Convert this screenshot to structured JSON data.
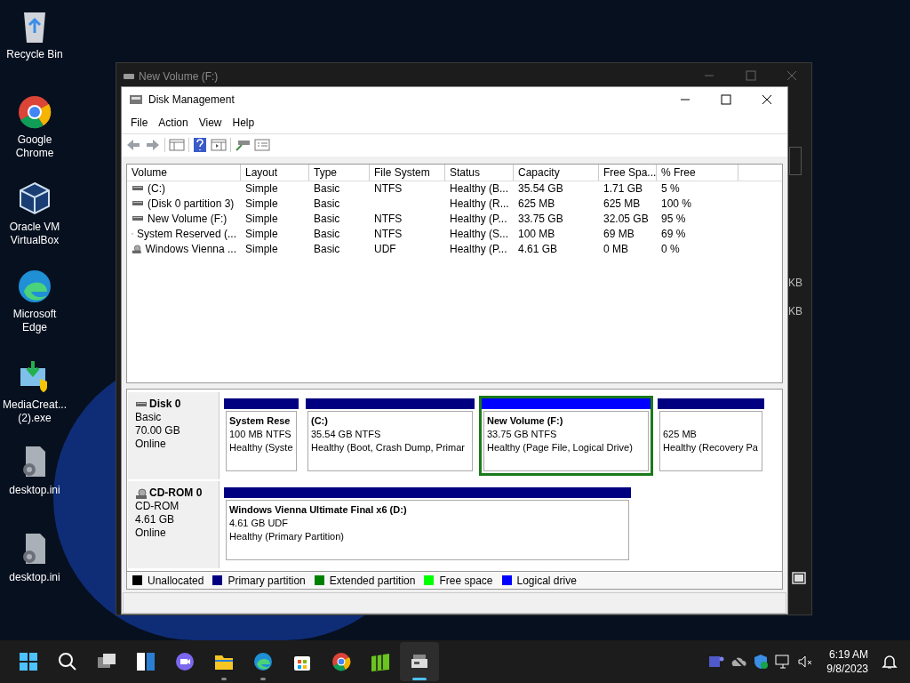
{
  "desktop_icons": [
    {
      "kind": "recycle",
      "label": "Recycle Bin"
    },
    {
      "kind": "chrome",
      "label": "Google Chrome"
    },
    {
      "kind": "vbox",
      "label": "Oracle VM VirtualBox"
    },
    {
      "kind": "edge",
      "label": "Microsoft Edge"
    },
    {
      "kind": "setup",
      "label": "MediaCreat... (2).exe"
    },
    {
      "kind": "ini",
      "label": "desktop.ini"
    },
    {
      "kind": "ini",
      "label": "desktop.ini"
    }
  ],
  "background_window": {
    "title": "New Volume (F:)",
    "column_texts": [
      "KB",
      "KB"
    ]
  },
  "window": {
    "title": "Disk Management",
    "menu": [
      "File",
      "Action",
      "View",
      "Help"
    ],
    "volume_table": {
      "columns": [
        "Volume",
        "Layout",
        "Type",
        "File System",
        "Status",
        "Capacity",
        "Free Spa...",
        "% Free"
      ],
      "rows": [
        {
          "kind": "disk",
          "cells": [
            " (C:)",
            "Simple",
            "Basic",
            "NTFS",
            "Healthy (B...",
            "35.54 GB",
            "1.71 GB",
            "5 %"
          ]
        },
        {
          "kind": "disk",
          "cells": [
            "(Disk 0 partition 3)",
            "Simple",
            "Basic",
            "",
            "Healthy (R...",
            "625 MB",
            "625 MB",
            "100 %"
          ]
        },
        {
          "kind": "disk",
          "cells": [
            "New Volume (F:)",
            "Simple",
            "Basic",
            "NTFS",
            "Healthy (P...",
            "33.75 GB",
            "32.05 GB",
            "95 %"
          ]
        },
        {
          "kind": "disk",
          "cells": [
            "System Reserved (...",
            "Simple",
            "Basic",
            "NTFS",
            "Healthy (S...",
            "100 MB",
            "69 MB",
            "69 %"
          ]
        },
        {
          "kind": "cdrom",
          "cells": [
            "Windows Vienna ...",
            "Simple",
            "Basic",
            "UDF",
            "Healthy (P...",
            "4.61 GB",
            "0 MB",
            "0 %"
          ]
        }
      ]
    },
    "disks": [
      {
        "kind": "disk",
        "name": "Disk 0",
        "type": "Basic",
        "size": "70.00 GB",
        "status": "Online",
        "partitions": [
          {
            "kind": "primary",
            "selected": false,
            "title": "System Rese",
            "detail": "100 MB NTFS",
            "status": "Healthy (Syste"
          },
          {
            "kind": "primary",
            "selected": false,
            "title": " (C:)",
            "detail": "35.54 GB NTFS",
            "status": "Healthy (Boot, Crash Dump, Primar"
          },
          {
            "kind": "logical",
            "selected": true,
            "title": "New Volume  (F:)",
            "detail": "33.75 GB NTFS",
            "status": "Healthy (Page File, Logical Drive)"
          },
          {
            "kind": "primary",
            "selected": false,
            "detail": "625 MB",
            "status": "Healthy (Recovery Pa"
          }
        ]
      },
      {
        "kind": "cdrom",
        "name": "CD-ROM 0",
        "type": "CD-ROM",
        "size": "4.61 GB",
        "status": "Online",
        "partitions": [
          {
            "kind": "primary",
            "selected": false,
            "title": "Windows Vienna Ultimate Final x6  (D:)",
            "detail": "4.61 GB UDF",
            "status": "Healthy (Primary Partition)"
          }
        ]
      }
    ],
    "legend": [
      {
        "label": "Unallocated",
        "color": "#000000"
      },
      {
        "label": "Primary partition",
        "color": "#000080"
      },
      {
        "label": "Extended partition",
        "color": "#008000"
      },
      {
        "label": "Free space",
        "color": "#00ff00"
      },
      {
        "label": "Logical drive",
        "color": "#0000ff"
      }
    ]
  },
  "taskbar": {
    "apps": [
      {
        "kind": "start",
        "selected": false,
        "running": false
      },
      {
        "kind": "search",
        "selected": false,
        "running": false
      },
      {
        "kind": "taskview",
        "selected": false,
        "running": false
      },
      {
        "kind": "widgets",
        "selected": false,
        "running": false
      },
      {
        "kind": "chat",
        "selected": false,
        "running": false
      },
      {
        "kind": "explorer",
        "selected": false,
        "running": true
      },
      {
        "kind": "edge",
        "selected": false,
        "running": true
      },
      {
        "kind": "store",
        "selected": false,
        "running": false
      },
      {
        "kind": "chrome",
        "selected": false,
        "running": false
      },
      {
        "kind": "green",
        "selected": false,
        "running": false
      },
      {
        "kind": "diskmgmt",
        "selected": true,
        "running": true
      }
    ],
    "time": "6:19 AM",
    "date": "9/8/2023"
  }
}
